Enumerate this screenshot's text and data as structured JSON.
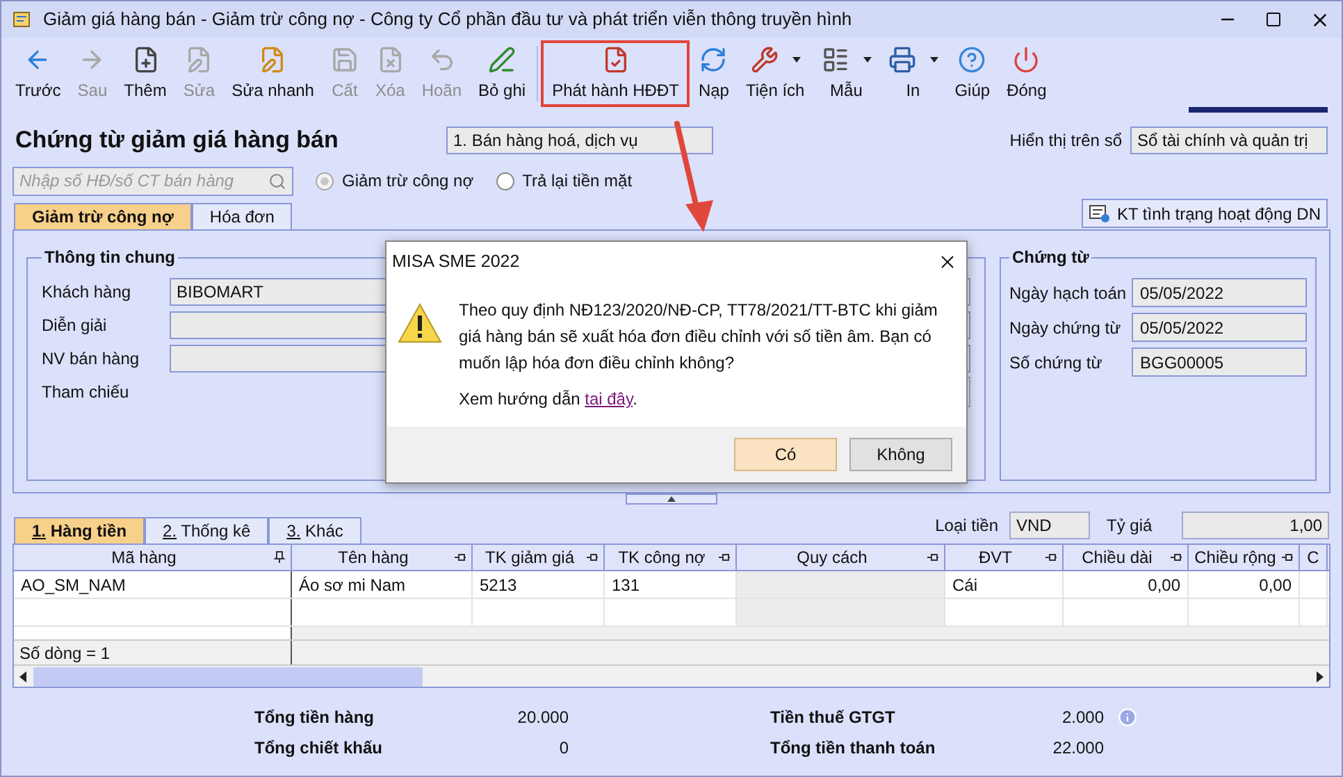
{
  "window": {
    "title": "Giảm giá hàng bán - Giảm trừ công nợ - Công ty Cổ phần đầu tư và phát triển viễn thông truyền hình"
  },
  "toolbar": [
    {
      "label": "Trước",
      "disabled": false,
      "dropdown": false,
      "highlighted": false
    },
    {
      "label": "Sau",
      "disabled": true,
      "dropdown": false,
      "highlighted": false
    },
    {
      "label": "Thêm",
      "disabled": false,
      "dropdown": false,
      "highlighted": false
    },
    {
      "label": "Sửa",
      "disabled": true,
      "dropdown": false,
      "highlighted": false
    },
    {
      "label": "Sửa nhanh",
      "disabled": false,
      "dropdown": false,
      "highlighted": false
    },
    {
      "label": "Cất",
      "disabled": true,
      "dropdown": false,
      "highlighted": false
    },
    {
      "label": "Xóa",
      "disabled": true,
      "dropdown": false,
      "highlighted": false
    },
    {
      "label": "Hoãn",
      "disabled": true,
      "dropdown": false,
      "highlighted": false
    },
    {
      "label": "Bỏ ghi",
      "disabled": false,
      "dropdown": false,
      "highlighted": false
    },
    {
      "label": "Phát hành HĐĐT",
      "disabled": false,
      "dropdown": false,
      "highlighted": true
    },
    {
      "label": "Nạp",
      "disabled": false,
      "dropdown": false,
      "highlighted": false
    },
    {
      "label": "Tiện ích",
      "disabled": false,
      "dropdown": true,
      "highlighted": false
    },
    {
      "label": "Mẫu",
      "disabled": false,
      "dropdown": true,
      "highlighted": false
    },
    {
      "label": "In",
      "disabled": false,
      "dropdown": true,
      "highlighted": false
    },
    {
      "label": "Giúp",
      "disabled": false,
      "dropdown": false,
      "highlighted": false
    },
    {
      "label": "Đóng",
      "disabled": false,
      "dropdown": false,
      "highlighted": false
    }
  ],
  "header": {
    "title": "Chứng từ giảm giá hàng bán",
    "category": "1. Bán hàng hoá, dịch vụ",
    "display_label": "Hiển thị trên sổ",
    "display_value": "Sổ tài chính và quản trị"
  },
  "search": {
    "placeholder": "Nhập số HĐ/số CT bán hàng"
  },
  "options": [
    {
      "label": "Giảm trừ công nợ",
      "selected": true
    },
    {
      "label": "Trả lại tiền mặt",
      "selected": false
    }
  ],
  "tabs": [
    {
      "label": "Giảm trừ công nợ",
      "selected": true
    },
    {
      "label": "Hóa đơn",
      "selected": false
    }
  ],
  "check_button": "KT tình trạng hoạt động DN",
  "general": {
    "title": "Thông tin chung",
    "fields": [
      {
        "label": "Khách hàng",
        "kind": "input",
        "value": "BIBOMART"
      },
      {
        "label": "Diễn giải",
        "kind": "input"
      },
      {
        "label": "NV bán hàng",
        "kind": "input"
      },
      {
        "label": "Tham chiếu",
        "kind": "lookup"
      }
    ]
  },
  "voucher": {
    "title": "Chứng từ",
    "fields": [
      {
        "label": "Ngày hạch toán",
        "value": "05/05/2022"
      },
      {
        "label": "Ngày chứng từ",
        "value": "05/05/2022"
      },
      {
        "label": "Số chứng từ",
        "value": "BGG00005"
      }
    ]
  },
  "detail_tabs": [
    {
      "label": "1. Hàng tiền",
      "selected": true
    },
    {
      "label": "2. Thống kê",
      "selected": false
    },
    {
      "label": "3. Khác",
      "selected": false
    }
  ],
  "currency": {
    "label": "Loại tiền",
    "value": "VND"
  },
  "rate": {
    "label": "Tỷ giá",
    "value": "1,00"
  },
  "grid": {
    "columns": [
      {
        "label": "Mã hàng",
        "pinned": true
      },
      {
        "label": "Tên hàng",
        "pinned": false
      },
      {
        "label": "TK giảm giá",
        "pinned": false
      },
      {
        "label": "TK công nợ",
        "pinned": false
      },
      {
        "label": "Quy cách",
        "pinned": false
      },
      {
        "label": "ĐVT",
        "pinned": false
      },
      {
        "label": "Chiều dài",
        "pinned": false
      },
      {
        "label": "Chiều rộng",
        "pinned": false
      },
      {
        "label": "C"
      }
    ],
    "rows": [
      [
        "AO_SM_NAM",
        "Áo sơ mi Nam",
        "5213",
        "131",
        "",
        "Cái",
        "0,00",
        "0,00",
        ""
      ]
    ],
    "row_count": "Số dòng = 1"
  },
  "totals": [
    {
      "label": "Tổng tiền hàng",
      "value": "20.000",
      "info": false
    },
    {
      "label": "Tiền thuế GTGT",
      "value": "2.000",
      "info": true
    },
    {
      "label": "Tổng chiết khấu",
      "value": "0",
      "info": false
    },
    {
      "label": "Tổng tiền thanh toán",
      "value": "22.000",
      "info": false
    }
  ],
  "dialog": {
    "title": "MISA SME 2022",
    "message": "Theo quy định NĐ123/2020/NĐ-CP, TT78/2021/TT-BTC khi giảm giá hàng bán sẽ xuất hóa đơn điều chỉnh với số tiền âm. Bạn có muốn lập hóa đơn điều chỉnh không?",
    "hint": "Xem hướng dẫn ",
    "link": "tai đây",
    "hint_end": ".",
    "buttons": [
      {
        "label": "Có",
        "default": true
      },
      {
        "label": "Không",
        "default": false
      }
    ]
  }
}
